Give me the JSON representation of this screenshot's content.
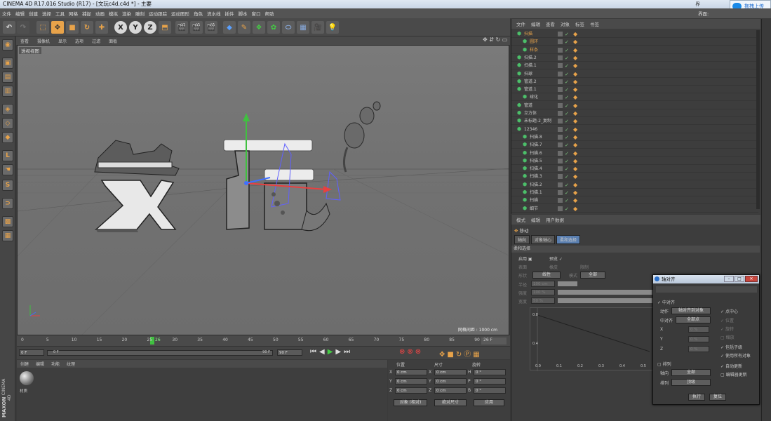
{
  "window": {
    "title": "CINEMA 4D R17.016 Studio (R17) - [文玩c4d.c4d *] - 主要",
    "interface_label": "界面:",
    "interface_value": "启动",
    "upload_label": "拖拽上传"
  },
  "menu": [
    "文件",
    "编辑",
    "创建",
    "选择",
    "工具",
    "网格",
    "捕捉",
    "动画",
    "模拟",
    "渲染",
    "雕刻",
    "运动跟踪",
    "运动图形",
    "角色",
    "流水线",
    "插件",
    "脚本",
    "窗口",
    "帮助"
  ],
  "toolbar": {
    "x": "X",
    "y": "Y",
    "z": "Z"
  },
  "viewport": {
    "menu": [
      "查看",
      "摄像机",
      "显示",
      "选项",
      "过滤",
      "面板"
    ],
    "label": "透视视图",
    "grid_info": "网格间距 : 1000 cm"
  },
  "timeline": {
    "ticks": [
      "0",
      "5",
      "10",
      "15",
      "20",
      "25",
      "30",
      "35",
      "40",
      "45",
      "50",
      "55",
      "60",
      "65",
      "70",
      "75",
      "80",
      "85",
      "90"
    ],
    "current": "26",
    "end_frame": "26 F"
  },
  "transport": {
    "start": "0 F",
    "min": "0 F",
    "max": "90 F",
    "end": "90 F"
  },
  "material": {
    "menu": [
      "创建",
      "编辑",
      "功能",
      "纹理"
    ],
    "item": "材质"
  },
  "coords": {
    "headers": [
      "位置",
      "尺寸",
      "旋转"
    ],
    "rows": [
      {
        "axis": "X",
        "pos": "0 cm",
        "size": "0 cm",
        "rlabel": "H",
        "rot": "0 °"
      },
      {
        "axis": "Y",
        "pos": "0 cm",
        "size": "0 cm",
        "rlabel": "P",
        "rot": "0 °"
      },
      {
        "axis": "Z",
        "pos": "0 cm",
        "size": "0 cm",
        "rlabel": "B",
        "rot": "0 °"
      }
    ],
    "mode": "对象 (相对)",
    "size_mode": "绝对尺寸",
    "apply": "应用"
  },
  "objects": {
    "menu": [
      "文件",
      "编辑",
      "查看",
      "对象",
      "标签",
      "书签"
    ],
    "rows": [
      {
        "name": "扫描",
        "indent": 0,
        "color": "#e8a34a"
      },
      {
        "name": "圆环",
        "indent": 1,
        "color": "#e8a34a"
      },
      {
        "name": "样条",
        "indent": 1,
        "color": "#e8a34a"
      },
      {
        "name": "扫描.2",
        "indent": 0,
        "color": "#c8c8c8"
      },
      {
        "name": "扫描.1",
        "indent": 0,
        "color": "#c8c8c8"
      },
      {
        "name": "扫球",
        "indent": 0,
        "color": "#c8c8c8"
      },
      {
        "name": "管道.2",
        "indent": 0,
        "color": "#c8c8c8"
      },
      {
        "name": "管道.1",
        "indent": 0,
        "color": "#c8c8c8"
      },
      {
        "name": "球化",
        "indent": 1,
        "color": "#c8c8c8"
      },
      {
        "name": "管道",
        "indent": 0,
        "color": "#c8c8c8"
      },
      {
        "name": "立方体",
        "indent": 0,
        "color": "#c8c8c8"
      },
      {
        "name": "未标题-2_复制",
        "indent": 0,
        "color": "#c8c8c8"
      },
      {
        "name": "12346",
        "indent": 0,
        "color": "#c8c8c8"
      },
      {
        "name": "扫描.8",
        "indent": 1,
        "color": "#c8c8c8"
      },
      {
        "name": "扫描.7",
        "indent": 1,
        "color": "#c8c8c8"
      },
      {
        "name": "扫描.6",
        "indent": 1,
        "color": "#c8c8c8"
      },
      {
        "name": "扫描.5",
        "indent": 1,
        "color": "#c8c8c8"
      },
      {
        "name": "扫描.4",
        "indent": 1,
        "color": "#c8c8c8"
      },
      {
        "name": "扫描.3",
        "indent": 1,
        "color": "#c8c8c8"
      },
      {
        "name": "扫描.2",
        "indent": 1,
        "color": "#c8c8c8"
      },
      {
        "name": "扫描.1",
        "indent": 1,
        "color": "#c8c8c8"
      },
      {
        "name": "扫描",
        "indent": 1,
        "color": "#c8c8c8"
      },
      {
        "name": "细节",
        "indent": 1,
        "color": "#c8c8c8"
      }
    ]
  },
  "attributes": {
    "menu": [
      "模式",
      "编辑",
      "用户数据"
    ],
    "tool": "移动",
    "tabs": [
      "轴向",
      "对象轴心",
      "柔和选择"
    ],
    "section": "柔和选择",
    "enable": "启用",
    "preview": "预览",
    "surface": "表面",
    "rubber": "橡皮",
    "restrict": "限制",
    "mode_label": "模式",
    "mode_value": "全部",
    "shape_label": "形状",
    "shape_value": "线性",
    "radius_label": "半径",
    "radius_value": "100 cm",
    "strength_label": "强度",
    "strength_value": "100 %",
    "width_label": "宽度",
    "width_value": "50 %",
    "graph_y": [
      "0.8",
      "0.4"
    ],
    "graph_x": [
      "0.0",
      "0.1",
      "0.2",
      "0.3",
      "0.4",
      "0.5"
    ]
  },
  "dialog": {
    "title": "轴对齐",
    "center": "中对齐",
    "action_label": "动作",
    "action_value": "轴对齐到对象",
    "point_center": "点中心",
    "align_label": "中对齐",
    "align_value": "全部点",
    "position": "位置",
    "rotation": "旋转",
    "scale": "缩放",
    "x": "X",
    "y": "Y",
    "z": "Z",
    "x_val": "0 %",
    "y_val": "0 %",
    "z_val": "0 %",
    "sequence": "排列",
    "axis_label": "轴向",
    "axis_value": "全部",
    "order_label": "排列",
    "order_value": "顶级",
    "include_children": "包括子级",
    "use_all": "使用所有对象",
    "auto_update": "自动更新",
    "editor_update": "编辑器更新",
    "execute": "执行",
    "reset": "复位"
  },
  "brand": [
    "MAXON",
    "CINEMA 4D"
  ],
  "colors": {
    "accent": "#e8a34a",
    "axis_x": "#e84040",
    "axis_y": "#40c040",
    "axis_z": "#4070ff"
  }
}
